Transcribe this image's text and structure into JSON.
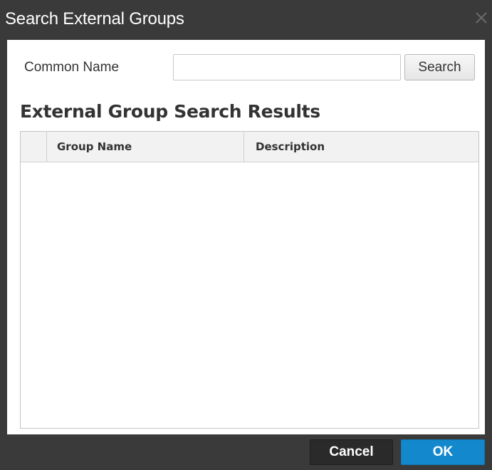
{
  "dialog": {
    "title": "Search External Groups",
    "close_icon": "close-icon"
  },
  "search": {
    "label": "Common Name",
    "value": "",
    "placeholder": "",
    "button_label": "Search"
  },
  "results": {
    "title": "External Group Search Results",
    "columns": [
      "",
      "Group Name",
      "Description"
    ],
    "rows": []
  },
  "footer": {
    "cancel_label": "Cancel",
    "ok_label": "OK"
  },
  "colors": {
    "dialog_chrome": "#3a3a3a",
    "primary_button": "#1488cc",
    "secondary_button": "#2a2a2a",
    "grid_header": "#f2f2f2"
  }
}
